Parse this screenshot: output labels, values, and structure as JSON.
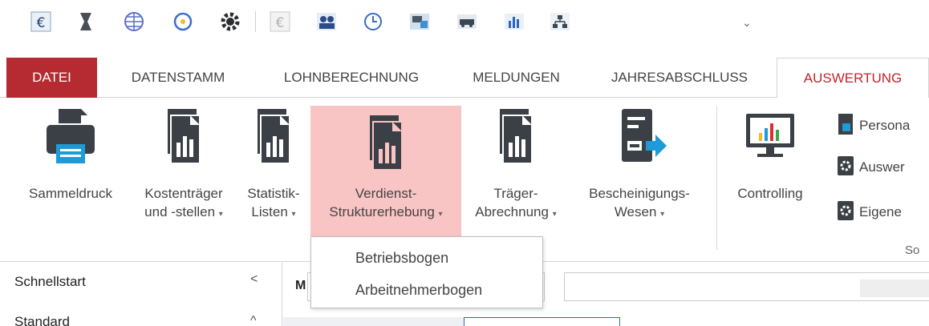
{
  "quick_access": {
    "icons": [
      "euro-icon",
      "hourglass-icon",
      "globe-grid-icon",
      "refresh-icon",
      "gear-icon",
      "euro-disabled-icon",
      "users-icon",
      "clock-icon",
      "photo-icon",
      "car-icon",
      "bar-chart-icon",
      "org-chart-icon"
    ],
    "more_glyph": "⌄"
  },
  "tabs": [
    {
      "label": "DATEI"
    },
    {
      "label": "DATENSTAMM"
    },
    {
      "label": "LOHNBERECHNUNG"
    },
    {
      "label": "MELDUNGEN"
    },
    {
      "label": "JAHRESABSCHLUSS"
    },
    {
      "label": "AUSWERTUNG"
    }
  ],
  "ribbon": {
    "buttons": [
      {
        "line1": "Sammeldruck",
        "line2": ""
      },
      {
        "line1": "Kostenträger",
        "line2": "und -stellen"
      },
      {
        "line1": "Statistik-",
        "line2": "Listen"
      },
      {
        "line1": "Verdienst-",
        "line2": "Strukturerhebung"
      },
      {
        "line1": "Träger-",
        "line2": "Abrechnung"
      },
      {
        "line1": "Bescheinigungs-",
        "line2": "Wesen"
      },
      {
        "line1": "Controlling",
        "line2": ""
      }
    ],
    "caret": "▾",
    "small_items": [
      "Persona",
      "Auswer",
      "Eigene"
    ],
    "group_label": "So"
  },
  "dropdown": {
    "items": [
      "Betriebsbogen",
      "Arbeitnehmerbogen"
    ]
  },
  "left_panel": {
    "schnellstart": "Schnellstart",
    "schnellstart_ctrl": "<",
    "standard": "Standard",
    "standard_ctrl": "^"
  },
  "content": {
    "tab_label": "M"
  },
  "colors": {
    "file_tab": "#b52b31",
    "active_tab_text": "#c2252d",
    "highlight": "#f9c4c4",
    "icon_dark": "#3b3f46",
    "icon_blue": "#1e9bd7"
  }
}
